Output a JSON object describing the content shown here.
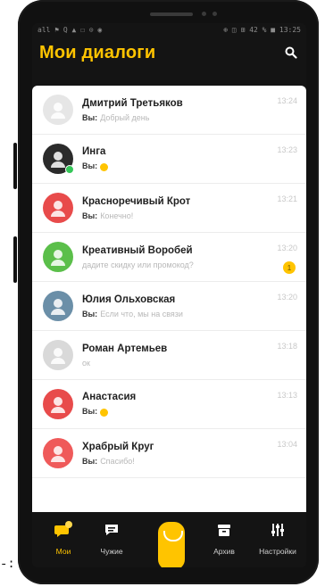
{
  "status_bar": {
    "left": "all ⚑ Q ▲ ☐ ⊙ ◉",
    "right": "⊕ ◫ ⊞ 42 % ■ 13:25"
  },
  "header": {
    "title": "Мои диалоги"
  },
  "dialogs": [
    {
      "name": "Дмитрий Третьяков",
      "prefix": "Вы:",
      "message": "Добрый день",
      "time": "13:24",
      "avatar_color": "#e6e6e6",
      "avatar_icon": "man-with-glasses"
    },
    {
      "name": "Инга",
      "prefix": "Вы:",
      "message": "",
      "emoji": "smile",
      "time": "13:23",
      "avatar_color": "#2b2b2b",
      "avatar_icon": "woman",
      "online": true
    },
    {
      "name": "Красноречивый Крот",
      "prefix": "Вы:",
      "message": "Конечно!",
      "time": "13:21",
      "avatar_color": "#e84b4b",
      "avatar_icon": "mole-icon"
    },
    {
      "name": "Креативный Воробей",
      "prefix": "",
      "message": "дадите скидку или промокод?",
      "time": "13:20",
      "badge": "1",
      "avatar_color": "#5bbf4a",
      "avatar_icon": "sparrow-icon"
    },
    {
      "name": "Юлия Ольховская",
      "prefix": "Вы:",
      "message": "Если что, мы на связи",
      "time": "13:20",
      "avatar_color": "#6b8fa8",
      "avatar_icon": "woman-outdoor"
    },
    {
      "name": "Роман Артемьев",
      "prefix": "",
      "message": "ок",
      "time": "13:18",
      "avatar_color": "#d9d9d9",
      "avatar_icon": "man"
    },
    {
      "name": "Анастасия",
      "prefix": "Вы:",
      "message": "",
      "emoji": "smile",
      "time": "13:13",
      "avatar_color": "#e84b4b",
      "avatar_icon": "face-icon"
    },
    {
      "name": "Храбрый Круг",
      "prefix": "Вы:",
      "message": "Спасибо!",
      "time": "13:04",
      "avatar_color": "#ef5a5a",
      "avatar_icon": "circle-face-icon"
    }
  ],
  "nav": [
    {
      "label": "Мои",
      "icon": "chat-bubble-icon",
      "active": true,
      "badge": "1"
    },
    {
      "label": "Чужие",
      "icon": "chat-lines-icon",
      "active": false
    },
    {
      "label": "Архив",
      "icon": "archive-icon",
      "active": false
    },
    {
      "label": "Настройки",
      "icon": "sliders-icon",
      "active": false
    }
  ],
  "colors": {
    "accent": "#ffc400",
    "background": "#141414",
    "list_bg": "#ffffff"
  }
}
